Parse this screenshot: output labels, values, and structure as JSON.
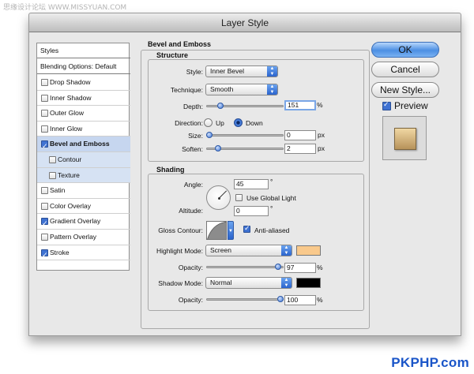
{
  "watermark_top": "思缘设计论坛 WWW.MISSYUAN.COM",
  "watermark_bottom": "PKPHP.com",
  "window": {
    "title": "Layer Style"
  },
  "styles_list": {
    "header": "Styles",
    "blending_options": "Blending Options: Default",
    "items": [
      {
        "label": "Drop Shadow",
        "checked": false
      },
      {
        "label": "Inner Shadow",
        "checked": false
      },
      {
        "label": "Outer Glow",
        "checked": false
      },
      {
        "label": "Inner Glow",
        "checked": false
      },
      {
        "label": "Bevel and Emboss",
        "checked": true,
        "selected": true
      },
      {
        "label": "Contour",
        "checked": false,
        "sub": true
      },
      {
        "label": "Texture",
        "checked": false,
        "sub": true
      },
      {
        "label": "Satin",
        "checked": false
      },
      {
        "label": "Color Overlay",
        "checked": false
      },
      {
        "label": "Gradient Overlay",
        "checked": true
      },
      {
        "label": "Pattern Overlay",
        "checked": false
      },
      {
        "label": "Stroke",
        "checked": true
      }
    ]
  },
  "bevel": {
    "title": "Bevel and Emboss",
    "structure_title": "Structure",
    "style_label": "Style:",
    "style_value": "Inner Bevel",
    "technique_label": "Technique:",
    "technique_value": "Smooth",
    "depth_label": "Depth:",
    "depth_value": "151",
    "depth_unit": "%",
    "depth_level": 0.151,
    "direction_label": "Direction:",
    "direction_up": "Up",
    "direction_down": "Down",
    "direction_selected": "Down",
    "size_label": "Size:",
    "size_value": "0",
    "size_unit": "px",
    "size_level": 0.0,
    "soften_label": "Soften:",
    "soften_value": "2",
    "soften_unit": "px",
    "soften_level": 0.125
  },
  "shading": {
    "title": "Shading",
    "angle_label": "Angle:",
    "angle_value": "45",
    "angle_unit": "°",
    "use_global_light_label": "Use Global Light",
    "use_global_light_checked": false,
    "altitude_label": "Altitude:",
    "altitude_value": "0",
    "altitude_unit": "°",
    "gloss_contour_label": "Gloss Contour:",
    "anti_aliased_label": "Anti-aliased",
    "anti_aliased_checked": true,
    "highlight_mode_label": "Highlight Mode:",
    "highlight_mode_value": "Screen",
    "highlight_color": "#f9c98c",
    "highlight_opacity_label": "Opacity:",
    "highlight_opacity_value": "97",
    "highlight_opacity_unit": "%",
    "highlight_opacity_level": 0.97,
    "shadow_mode_label": "Shadow Mode:",
    "shadow_mode_value": "Normal",
    "shadow_color": "#000000",
    "shadow_opacity_label": "Opacity:",
    "shadow_opacity_value": "100",
    "shadow_opacity_unit": "%",
    "shadow_opacity_level": 1.0
  },
  "buttons": {
    "ok": "OK",
    "cancel": "Cancel",
    "new_style": "New Style...",
    "preview_label": "Preview",
    "preview_checked": true
  }
}
